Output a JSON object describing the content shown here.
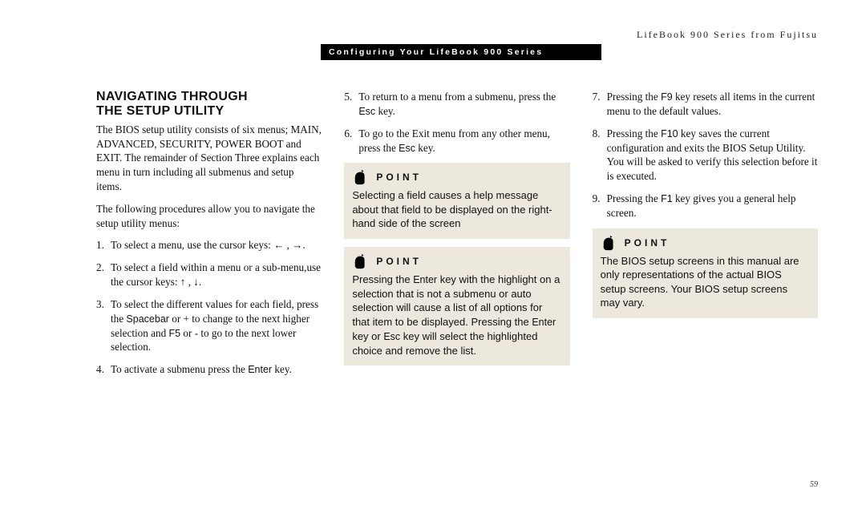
{
  "header": {
    "product_line": "LifeBook 900 Series from Fujitsu",
    "section_bar": "Configuring Your LifeBook 900 Series"
  },
  "col1": {
    "title_line1": "NAVIGATING THROUGH",
    "title_line2": "THE SETUP UTILITY",
    "intro": "The BIOS setup utility consists of six menus; MAIN, ADVANCED, SECURITY, POWER BOOT and EXIT. The remainder of Section Three explains each menu in turn including all submenus and setup items.",
    "lead": "The following procedures allow you to navigate the setup utility menus:",
    "items": [
      {
        "n": "1.",
        "t": "To select a menu, use the cursor keys: ",
        "tail": " , ",
        "a1": "←",
        "a2": "→",
        "end": "."
      },
      {
        "n": "2.",
        "t": "To select a field within a menu or a sub-menu,use the cursor keys: ",
        "tail": " , ",
        "a1": "↑",
        "a2": "↓",
        "end": "."
      },
      {
        "n": "3.",
        "t": "To select the different values for each field, press the ",
        "sp": "Spacebar",
        "mid": " or + to change to the next higher selection and ",
        "sp2": "F5",
        "mid2": " or - to go to the next lower selection."
      },
      {
        "n": "4.",
        "t": "To activate a submenu press the ",
        "sp": "Enter",
        "end": " key."
      }
    ]
  },
  "col2": {
    "items": [
      {
        "n": "5.",
        "t": "To return to a menu from a submenu, press the ",
        "sp": "Esc",
        "end": " key."
      },
      {
        "n": "6.",
        "t": "To go to the Exit menu from any other menu, press the ",
        "sp": "Esc",
        "end": " key."
      }
    ],
    "point1": {
      "label": "POINT",
      "body": "Selecting a field causes a help message about that field to be displayed on the right-hand side of the screen"
    },
    "point2": {
      "label": "POINT",
      "body_a": "Pressing the ",
      "sp1": "Enter",
      "body_b": " key with the highlight on a selection that is not a submenu or auto selection will cause a list of all options for that item to be displayed. Pressing the ",
      "sp2": "Enter",
      "body_c": " key or ",
      "sp3": "Esc",
      "body_d": " key will select the highlighted choice and remove the list."
    }
  },
  "col3": {
    "items": [
      {
        "n": "7.",
        "t": "Pressing the ",
        "sp": "F9",
        "end": " key resets all items in the current menu to the default values."
      },
      {
        "n": "8.",
        "t": "Pressing the ",
        "sp": "F10",
        "end": " key saves the current configuration and exits the BIOS Setup Utility. You will be asked to verify this selection before it is executed."
      },
      {
        "n": "9.",
        "t": "Pressing the ",
        "sp": "F1",
        "end": " key gives you a general help screen."
      }
    ],
    "point": {
      "label": "POINT",
      "body": "The BIOS setup screens in this manual are only representations of the actual BIOS setup screens. Your BIOS setup screens may vary."
    }
  },
  "page_number": "59"
}
